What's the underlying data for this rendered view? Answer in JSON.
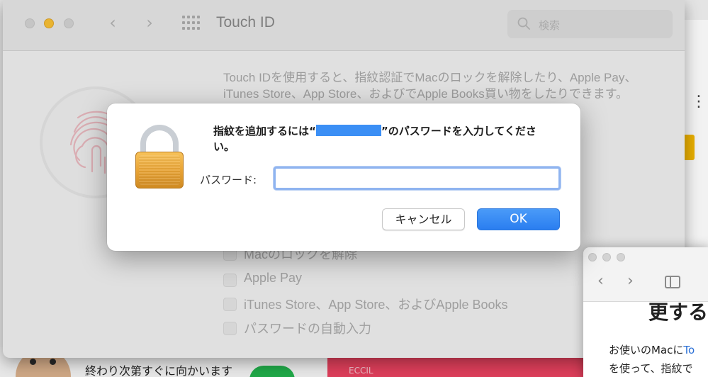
{
  "background": {
    "status_text": "終わり次第すぐに向かいます",
    "banner_text": "ECCIL"
  },
  "prefs": {
    "title": "Touch ID",
    "search": {
      "placeholder": "検索"
    },
    "description": "Touch IDを使用すると、指紋認証でMacのロックを解除したり、Apple Pay、iTunes Store、App Store、およびでApple Books買い物をしたりできます。",
    "options": [
      {
        "label": "Macのロックを解除",
        "checked": false
      },
      {
        "label": "Apple Pay",
        "checked": false
      },
      {
        "label": "iTunes Store、App Store、およびApple Books",
        "checked": false
      },
      {
        "label": "パスワードの自動入力",
        "checked": false
      }
    ]
  },
  "dialog": {
    "message_before": "指紋を追加するには“",
    "message_after": "”のパスワードを入力してください。",
    "password_label": "パスワード:",
    "password_value": "",
    "cancel_label": "キャンセル",
    "ok_label": "OK"
  },
  "mini_window": {
    "heading": "更する",
    "line1_prefix": "お使いのMacに",
    "line1_link": "To",
    "line2": "を使って、指紋で"
  },
  "colors": {
    "accent": "#2a7ef0",
    "lock_gold": "#e9a435",
    "redaction": "#3b8ff5",
    "traffic_minimize": "#f6be34"
  }
}
